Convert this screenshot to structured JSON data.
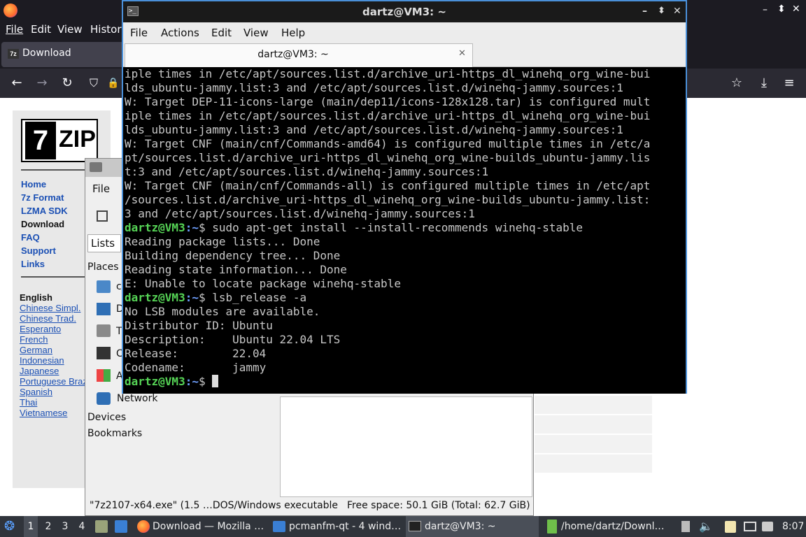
{
  "firefox": {
    "menu": [
      "File",
      "Edit",
      "View",
      "History"
    ],
    "tab_title": "Download"
  },
  "sevenzip": {
    "logo_seven": "7",
    "logo_zip": "ZIP",
    "nav": [
      "Home",
      "7z Format",
      "LZMA SDK",
      "Download",
      "FAQ",
      "Support",
      "Links"
    ],
    "languages_heading": "English",
    "languages": [
      "Chinese Simpl.",
      "Chinese Trad.",
      "Esperanto",
      "French",
      "German",
      "Indonesian",
      "Japanese",
      "Portuguese Braz",
      "Spanish",
      "Thai",
      "Vietnamese"
    ]
  },
  "filemanager": {
    "menu_file": "File",
    "lists_label": "Lists",
    "places_heading": "Places",
    "places_partial": [
      "c",
      "D",
      "T",
      "C",
      "A"
    ],
    "network": "Network",
    "devices": "Devices",
    "bookmarks": "Bookmarks",
    "status_file": "\"7z2107-x64.exe\" (1.5 …DOS/Windows executable",
    "status_free": "Free space: 50.1 GiB (Total: 62.7 GiB)"
  },
  "terminal": {
    "title": "dartz@VM3: ~",
    "menu": [
      "File",
      "Actions",
      "Edit",
      "View",
      "Help"
    ],
    "tab_title": "dartz@VM3: ~",
    "prompt_user": "dartz@VM3",
    "prompt_path": ":~",
    "lines": [
      {
        "t": "iple times in /etc/apt/sources.list.d/archive_uri-https_dl_winehq_org_wine-bui"
      },
      {
        "t": "lds_ubuntu-jammy.list:3 and /etc/apt/sources.list.d/winehq-jammy.sources:1"
      },
      {
        "t": "W: Target DEP-11-icons-large (main/dep11/icons-128x128.tar) is configured mult"
      },
      {
        "t": "iple times in /etc/apt/sources.list.d/archive_uri-https_dl_winehq_org_wine-bui"
      },
      {
        "t": "lds_ubuntu-jammy.list:3 and /etc/apt/sources.list.d/winehq-jammy.sources:1"
      },
      {
        "t": "W: Target CNF (main/cnf/Commands-amd64) is configured multiple times in /etc/a"
      },
      {
        "t": "pt/sources.list.d/archive_uri-https_dl_winehq_org_wine-builds_ubuntu-jammy.lis"
      },
      {
        "t": "t:3 and /etc/apt/sources.list.d/winehq-jammy.sources:1"
      },
      {
        "t": "W: Target CNF (main/cnf/Commands-all) is configured multiple times in /etc/apt"
      },
      {
        "t": "/sources.list.d/archive_uri-https_dl_winehq_org_wine-builds_ubuntu-jammy.list:"
      },
      {
        "t": "3 and /etc/apt/sources.list.d/winehq-jammy.sources:1"
      },
      {
        "cmd": "$ sudo apt-get install --install-recommends winehq-stable"
      },
      {
        "t": "Reading package lists... Done"
      },
      {
        "t": "Building dependency tree... Done"
      },
      {
        "t": "Reading state information... Done"
      },
      {
        "t": "E: Unable to locate package winehq-stable"
      },
      {
        "cmd": "$ lsb_release -a"
      },
      {
        "t": "No LSB modules are available."
      },
      {
        "t": "Distributor ID:\tUbuntu"
      },
      {
        "t": "Description:\tUbuntu 22.04 LTS"
      },
      {
        "t": "Release:\t22.04"
      },
      {
        "t": "Codename:\tjammy"
      },
      {
        "cmd": "$ "
      }
    ]
  },
  "taskbar": {
    "workspaces": [
      "1",
      "2",
      "3",
      "4"
    ],
    "tasks": [
      "Download — Mozilla …",
      "pcmanfm-qt - 4 wind…",
      "dartz@VM3: ~",
      "/home/dartz/Downl…"
    ],
    "clock": "8:07"
  }
}
